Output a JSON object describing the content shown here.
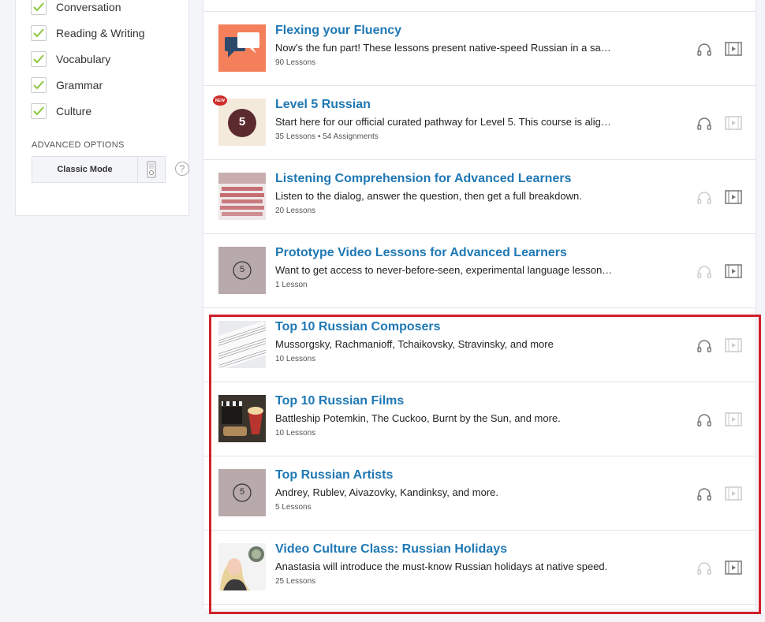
{
  "sidebar": {
    "filters": [
      {
        "label": "Conversation",
        "checked": true
      },
      {
        "label": "Reading & Writing",
        "checked": true
      },
      {
        "label": "Vocabulary",
        "checked": true
      },
      {
        "label": "Grammar",
        "checked": true
      },
      {
        "label": "Culture",
        "checked": true
      }
    ],
    "advanced_title": "ADVANCED OPTIONS",
    "mode_label": "Classic Mode",
    "help_glyph": "?"
  },
  "badge": {
    "new": "NEW"
  },
  "rows": [
    {
      "title": "Flexing your Fluency",
      "description": "Now's the fun part! These lessons present native-speed Russian in a sa…",
      "meta": "90 Lessons",
      "audio": true,
      "video": true,
      "thumb": "speech-bubbles"
    },
    {
      "title": "Level 5 Russian",
      "description": "Start here for our official curated pathway for Level 5. This course is alig…",
      "meta": "35 Lessons • 54 Assignments",
      "audio": true,
      "video": false,
      "thumb": "level-5-circle",
      "thumb_text": "5"
    },
    {
      "title": "Listening Comprehension for Advanced Learners",
      "description": "Listen to the dialog, answer the question, then get a full breakdown.",
      "meta": "20 Lessons",
      "audio": false,
      "video": true,
      "thumb": "auditorium"
    },
    {
      "title": "Prototype Video Lessons for Advanced Learners",
      "description": "Want to get access to never-before-seen, experimental language lesson…",
      "meta": "1 Lesson",
      "audio": false,
      "video": true,
      "thumb": "level-5-outline",
      "thumb_text": "5"
    },
    {
      "title": "Top 10 Russian Composers",
      "description": "Mussorgsky, Rachmanioff, Tchaikovsky, Stravinsky, and more",
      "meta": "10 Lessons",
      "audio": true,
      "video": false,
      "thumb": "sheet-music"
    },
    {
      "title": "Top 10 Russian Films",
      "description": "Battleship Potemkin, The Cuckoo, Burnt by the Sun, and more.",
      "meta": "10 Lessons",
      "audio": true,
      "video": false,
      "thumb": "film-clapper"
    },
    {
      "title": "Top Russian Artists",
      "description": "Andrey, Rublev, Aivazovky, Kandinksy, and more.",
      "meta": "5 Lessons",
      "audio": true,
      "video": false,
      "thumb": "level-5-outline",
      "thumb_text": "5"
    },
    {
      "title": "Video Culture Class: Russian Holidays",
      "description": "Anastasia will introduce the must-know Russian holidays at native speed.",
      "meta": "25 Lessons",
      "audio": false,
      "video": true,
      "thumb": "host-photo"
    }
  ],
  "colors": {
    "title": "#1f78b4",
    "check": "#8cc63f",
    "highlight": "#d0202a",
    "new_badge": "#cf2d2d"
  }
}
